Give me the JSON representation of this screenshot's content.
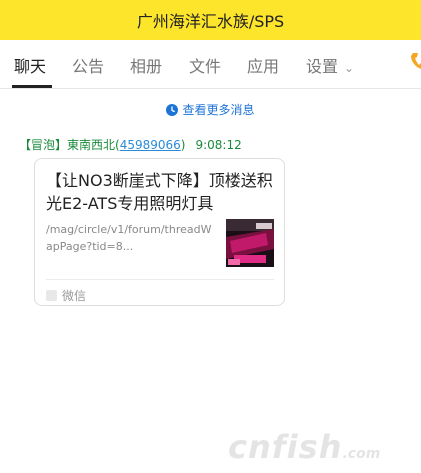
{
  "header": {
    "title": "广州海洋汇水族/SPS"
  },
  "tabs": [
    {
      "label": "聊天",
      "active": true
    },
    {
      "label": "公告"
    },
    {
      "label": "相册"
    },
    {
      "label": "文件"
    },
    {
      "label": "应用"
    },
    {
      "label": "设置"
    }
  ],
  "more_messages": {
    "label": "查看更多消息",
    "icon": "clock-icon"
  },
  "message": {
    "badge": "【冒泡】",
    "sender_name": "東南西北",
    "open_paren": "(",
    "qq_number": "45989066",
    "close_paren": ")",
    "time": "9:08:12",
    "card": {
      "title": "【让NO3断崖式下降】顶楼送积光E2-ATS专用照明灯具",
      "description": "/mag/circle/v1/forum/threadWapPage?tid=8...",
      "source": "微信"
    }
  },
  "watermark": {
    "text": "cnfish",
    "suffix": ".com"
  },
  "colors": {
    "header_bg": "#fde52c",
    "link_blue": "#1d74d8",
    "sender_green": "#1a8a3a",
    "edge_icon": "#f5a623"
  }
}
